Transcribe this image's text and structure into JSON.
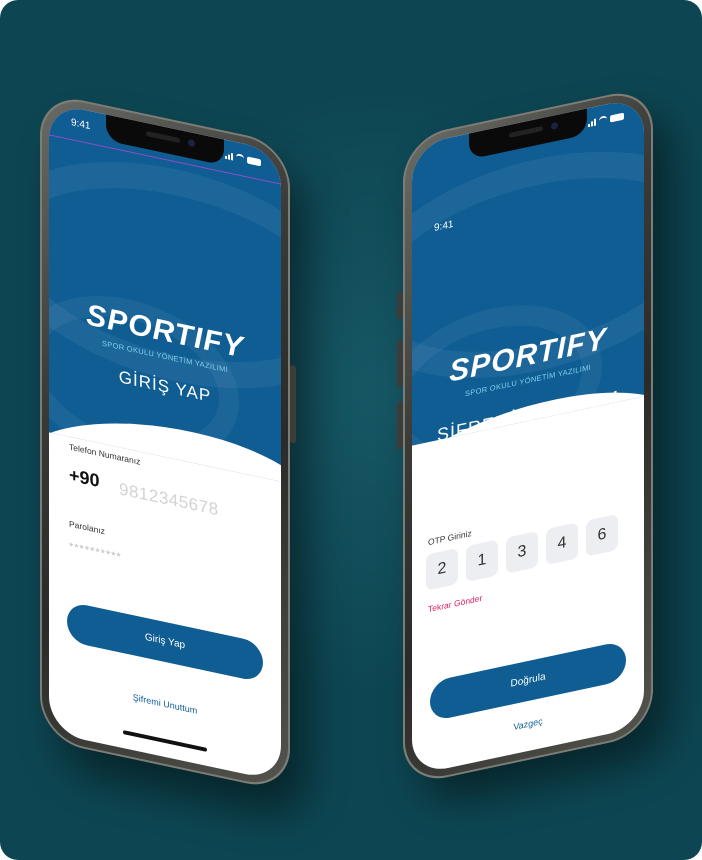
{
  "brand": {
    "name": "SPORTIFY",
    "tagline": "SPOR OKULU YÖNETİM YAZILIMI",
    "primary_color": "#0f5d93",
    "accent_color": "#e0245e",
    "background_color": "#0d4652"
  },
  "login_phone": {
    "status": {
      "time": "9:41"
    },
    "title": "GİRİŞ YAP",
    "phone_label": "Telefon Numaranız",
    "country_code": "+90",
    "phone_placeholder": "9812345678",
    "password_label": "Parolanız",
    "password_placeholder": "**********",
    "login_button": "Giriş Yap",
    "forgot_link": "Şifremi Unuttum"
  },
  "otp_phone": {
    "status": {
      "time": "9:41"
    },
    "title": "ŞİFREMİ UNUTTUM",
    "otp_label": "OTP Giriniz",
    "otp_digits": [
      "2",
      "1",
      "3",
      "4",
      "6"
    ],
    "resend_link": "Tekrar Gönder",
    "verify_button": "Doğrula",
    "cancel_link": "Vazgeç"
  }
}
